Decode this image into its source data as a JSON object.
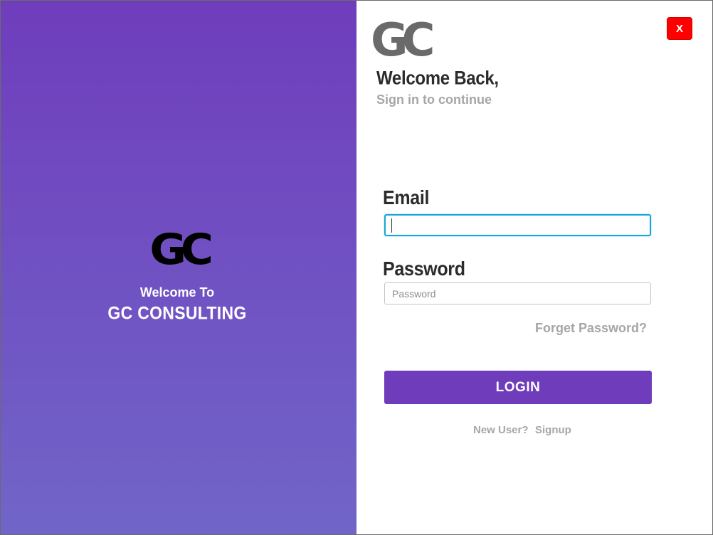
{
  "left_panel": {
    "logo_text": "GC",
    "welcome": "Welcome To",
    "company": "GC CONSULTING"
  },
  "right_panel": {
    "close_label": "X",
    "logo_text": "GC",
    "welcome_back": "Welcome Back,",
    "subtitle": "Sign in to continue"
  },
  "form": {
    "email_label": "Email",
    "email_value": "",
    "password_label": "Password",
    "password_placeholder": "Password",
    "forgot_label": "Forget Password?",
    "login_label": "LOGIN",
    "new_user_label": "New User?",
    "signup_label": "Signup"
  },
  "colors": {
    "primary": "#6f3dbc",
    "gradient_end": "#7165c8",
    "close": "#ff0000",
    "focus": "#1aa6d6",
    "muted_text": "#a6a6a6"
  }
}
